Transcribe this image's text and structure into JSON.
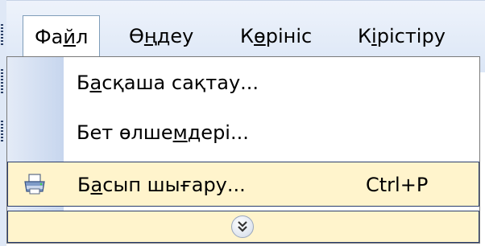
{
  "menubar": {
    "items": [
      {
        "before": "Фа",
        "mnemonic": "й",
        "after": "л"
      },
      {
        "before": "Ө",
        "mnemonic": "ң",
        "after": "деу"
      },
      {
        "before": "К",
        "mnemonic": "ө",
        "after": "рініс"
      },
      {
        "before": "К",
        "mnemonic": "і",
        "after": "рістіру"
      }
    ]
  },
  "menu": {
    "items": [
      {
        "before": "Б",
        "mnemonic": "а",
        "after": "сқаша сақтау..."
      },
      {
        "before": "Бет өлше",
        "mnemonic": "м",
        "after": "дері..."
      },
      {
        "before": "Б",
        "mnemonic": "а",
        "after": "сып шығару...",
        "shortcut": "Ctrl+P",
        "icon": "printer-icon"
      }
    ],
    "expand_icon": "double-chevron-down-icon"
  },
  "colors": {
    "menubar_bg": "#dbe6f6",
    "highlight_bg": "#fff4cc",
    "highlight_border": "#2a3d6b",
    "icon_column": "#c7d6ee"
  }
}
